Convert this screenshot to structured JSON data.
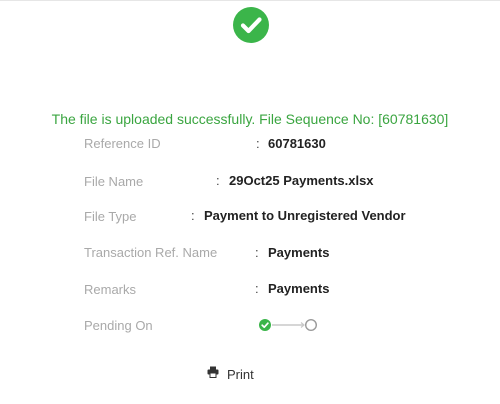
{
  "status": {
    "message": "The file is uploaded successfully. File Sequence No: [60781630]",
    "icon": "check-circle-icon",
    "color": "#3bb54a"
  },
  "details": {
    "reference_id": {
      "label": "Reference ID",
      "value": "60781630"
    },
    "file_name": {
      "label": "File Name",
      "value": "29Oct25 Payments.xlsx"
    },
    "file_type": {
      "label": "File Type",
      "value": "Payment to Unregistered Vendor"
    },
    "transaction_ref_name": {
      "label": "Transaction Ref. Name",
      "value": "Payments"
    },
    "remarks": {
      "label": "Remarks",
      "value": "Payments"
    },
    "pending_on": {
      "label": "Pending On",
      "steps_completed": 1,
      "steps_total": 2
    }
  },
  "separator": ":",
  "actions": {
    "print_label": "Print",
    "print_icon": "printer-icon"
  }
}
